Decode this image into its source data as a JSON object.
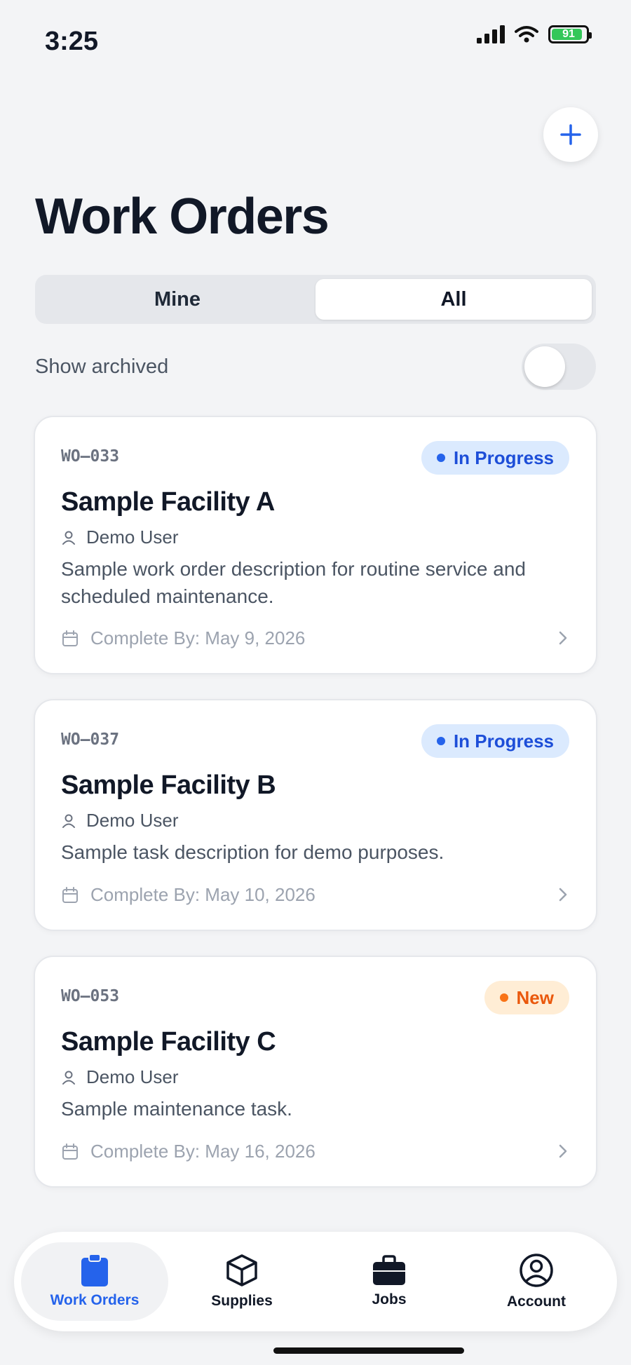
{
  "status_bar": {
    "time": "3:25",
    "battery": "91"
  },
  "header": {
    "title": "Work Orders",
    "add_icon": "plus-icon"
  },
  "filter": {
    "tabs": [
      {
        "label": "Mine"
      },
      {
        "label": "All"
      }
    ],
    "selected": "All"
  },
  "archived": {
    "label": "Show archived",
    "on": false
  },
  "colors": {
    "accent": "#2563eb",
    "in_progress_bg": "#dbeafe",
    "in_progress_fg": "#1d4ed8",
    "new_bg": "#ffedd5",
    "new_fg": "#ea580c",
    "battery_green": "#34c759"
  },
  "work_orders": [
    {
      "id": "WO–033",
      "status": "In Progress",
      "title": "Sample Facility A",
      "assignee": "Demo User",
      "description": "Sample work order description for routine service and scheduled maintenance.",
      "due": "Complete By: May 9, 2026"
    },
    {
      "id": "WO–037",
      "status": "In Progress",
      "title": "Sample Facility B",
      "assignee": "Demo User",
      "description": "Sample task description for demo purposes.",
      "due": "Complete By: May 10, 2026"
    },
    {
      "id": "WO–053",
      "status": "New",
      "title": "Sample Facility C",
      "assignee": "Demo User",
      "description": "Sample maintenance task.",
      "due": "Complete By: May 16, 2026"
    }
  ],
  "tab_bar": [
    {
      "label": "Work Orders",
      "icon": "clipboard-icon",
      "active": true
    },
    {
      "label": "Supplies",
      "icon": "box-icon"
    },
    {
      "label": "Jobs",
      "icon": "briefcase-icon"
    },
    {
      "label": "Account",
      "icon": "user-circle-icon"
    }
  ]
}
